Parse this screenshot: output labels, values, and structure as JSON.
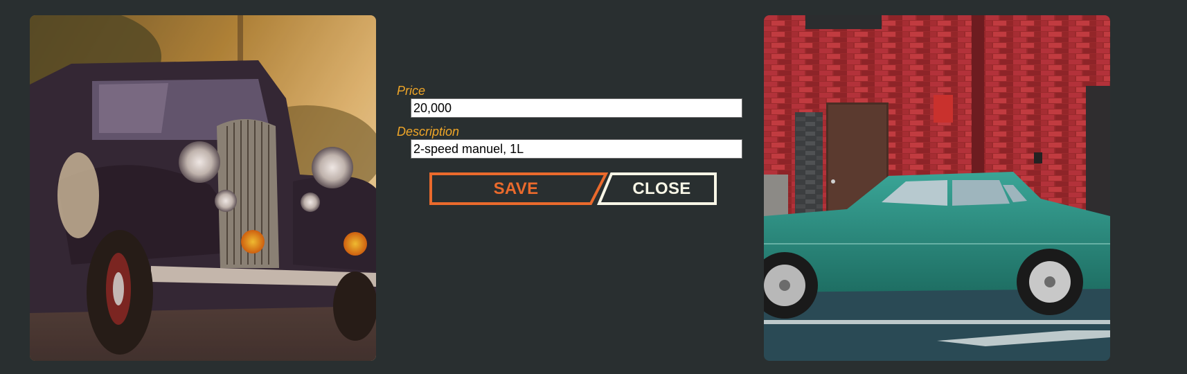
{
  "photos": {
    "left_alt": "vintage-black-car",
    "right_alt": "green-sedan-brick-wall"
  },
  "form": {
    "price_label": "Price",
    "price_value": "20,000",
    "description_label": "Description",
    "description_value": "2-speed manuel, 1L"
  },
  "actions": {
    "save_label": "SAVE",
    "close_label": "CLOSE"
  },
  "colors": {
    "background": "#292f30",
    "label": "#f0a628",
    "save_accent": "#ea6a2c",
    "close_accent": "#f8f6e6"
  }
}
